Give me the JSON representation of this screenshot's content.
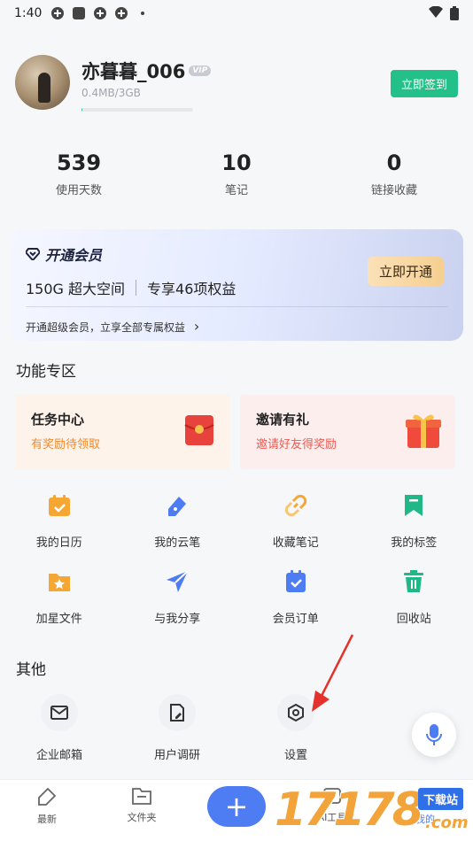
{
  "status_bar": {
    "time": "1:40"
  },
  "profile": {
    "username": "亦暮暮_006",
    "vip_badge": "VIP",
    "storage_text": "0.4MB/3GB",
    "storage_fraction": 0.0001,
    "signin_label": "立即签到"
  },
  "stats": [
    {
      "value": "539",
      "label": "使用天数"
    },
    {
      "value": "10",
      "label": "笔记"
    },
    {
      "value": "0",
      "label": "链接收藏"
    }
  ],
  "membership": {
    "title": "开通会员",
    "space": "150G 超大空间",
    "benefits": "专享46项权益",
    "button": "立即开通",
    "footer": "开通超级会员，立享全部专属权益",
    "chevron": "›"
  },
  "features": {
    "title": "功能专区",
    "task": {
      "title": "任务中心",
      "subtitle": "有奖励待领取"
    },
    "invite": {
      "title": "邀请有礼",
      "subtitle": "邀请好友得奖励"
    },
    "grid_row1": [
      {
        "label": "我的日历",
        "icon": "calendar-icon"
      },
      {
        "label": "我的云笔",
        "icon": "pen-icon"
      },
      {
        "label": "收藏笔记",
        "icon": "link-icon"
      },
      {
        "label": "我的标签",
        "icon": "bookmark-icon"
      }
    ],
    "grid_row2": [
      {
        "label": "加星文件",
        "icon": "star-folder-icon"
      },
      {
        "label": "与我分享",
        "icon": "send-icon"
      },
      {
        "label": "会员订单",
        "icon": "order-icon"
      },
      {
        "label": "回收站",
        "icon": "trash-icon"
      }
    ]
  },
  "others": {
    "title": "其他",
    "items": [
      {
        "label": "企业邮箱",
        "icon": "mail-icon"
      },
      {
        "label": "用户调研",
        "icon": "survey-icon"
      },
      {
        "label": "设置",
        "icon": "settings-icon"
      }
    ]
  },
  "bottom_nav": [
    {
      "label": "最新",
      "icon": "recent-icon"
    },
    {
      "label": "文件夹",
      "icon": "folder-icon"
    },
    {
      "label": "AI工具",
      "icon": "ai-icon"
    },
    {
      "label": "我的",
      "icon": "me-icon"
    }
  ],
  "plus_label": "+",
  "watermark": {
    "number": "17178",
    "tag": "下载站",
    "domain": ".com"
  },
  "colors": {
    "accent_green": "#23c089",
    "accent_blue": "#4d7cf3",
    "arrow_red": "#e5312b"
  }
}
